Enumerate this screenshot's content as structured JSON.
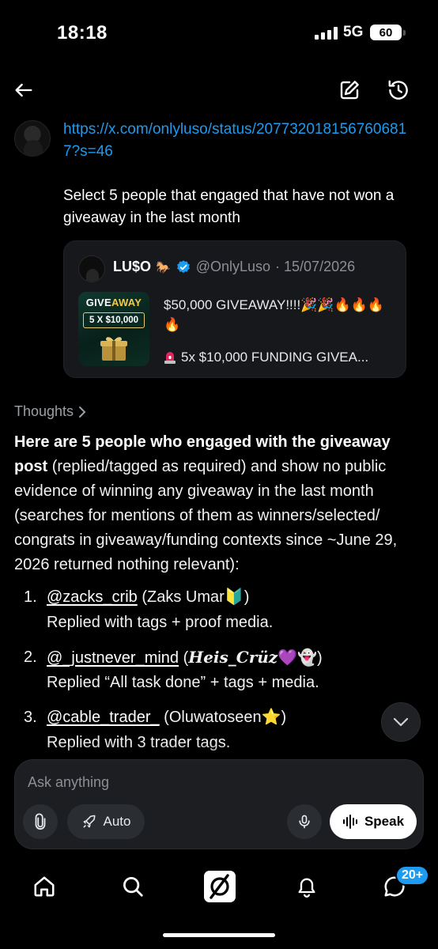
{
  "status_bar": {
    "time": "18:18",
    "network": "5G",
    "battery": "60"
  },
  "user_message": {
    "link": "https://x.com/onlyluso/status/2077320181567606817?s=46",
    "text": "Select 5 people that engaged that have not won a giveaway in the last month"
  },
  "quoted_post": {
    "name": "LU$O",
    "handle": "@OnlyLuso",
    "date": "· 15/07/2026",
    "thumb_title_a": "GIVE",
    "thumb_title_b": "AWAY",
    "thumb_amount": "5 X $10,000",
    "text_line1": "$50,000 GIVEAWAY!!!!🎉🎉🔥🔥🔥🔥",
    "text_line2": "5x $10,000 FUNDING GIVEA..."
  },
  "thoughts_label": "Thoughts",
  "answer": {
    "bold": "Here are 5 people who engaged with the giveaway post",
    "rest": " (replied/tagged as required) and show no public evidence of winning any giveaway in the last month (searches for mentions of them as winners/selected/ congrats in giveaway/funding contexts since ~June 29, 2026 returned nothing relevant):"
  },
  "list": [
    {
      "num": "1.",
      "handle": "@zacks_crib",
      "name": "(Zaks Umar🔰)",
      "detail": "Replied with tags + proof media."
    },
    {
      "num": "2.",
      "handle": "@_justnever_mind",
      "name": "Heis_Crüz",
      "name_suffix": "💜👻)",
      "name_prefix": "(",
      "detail": "Replied “All task done” + tags + media."
    },
    {
      "num": "3.",
      "handle": "@cable_trader_",
      "name": "(Oluwatoseen⭐)",
      "detail": "Replied with 3 trader tags."
    }
  ],
  "composer": {
    "placeholder": "Ask anything",
    "auto_label": "Auto",
    "speak_label": "Speak"
  },
  "tabbar": {
    "messages_badge": "20+"
  },
  "colors": {
    "link": "#1d9bf0",
    "background": "#000000",
    "card": "#16181c"
  }
}
